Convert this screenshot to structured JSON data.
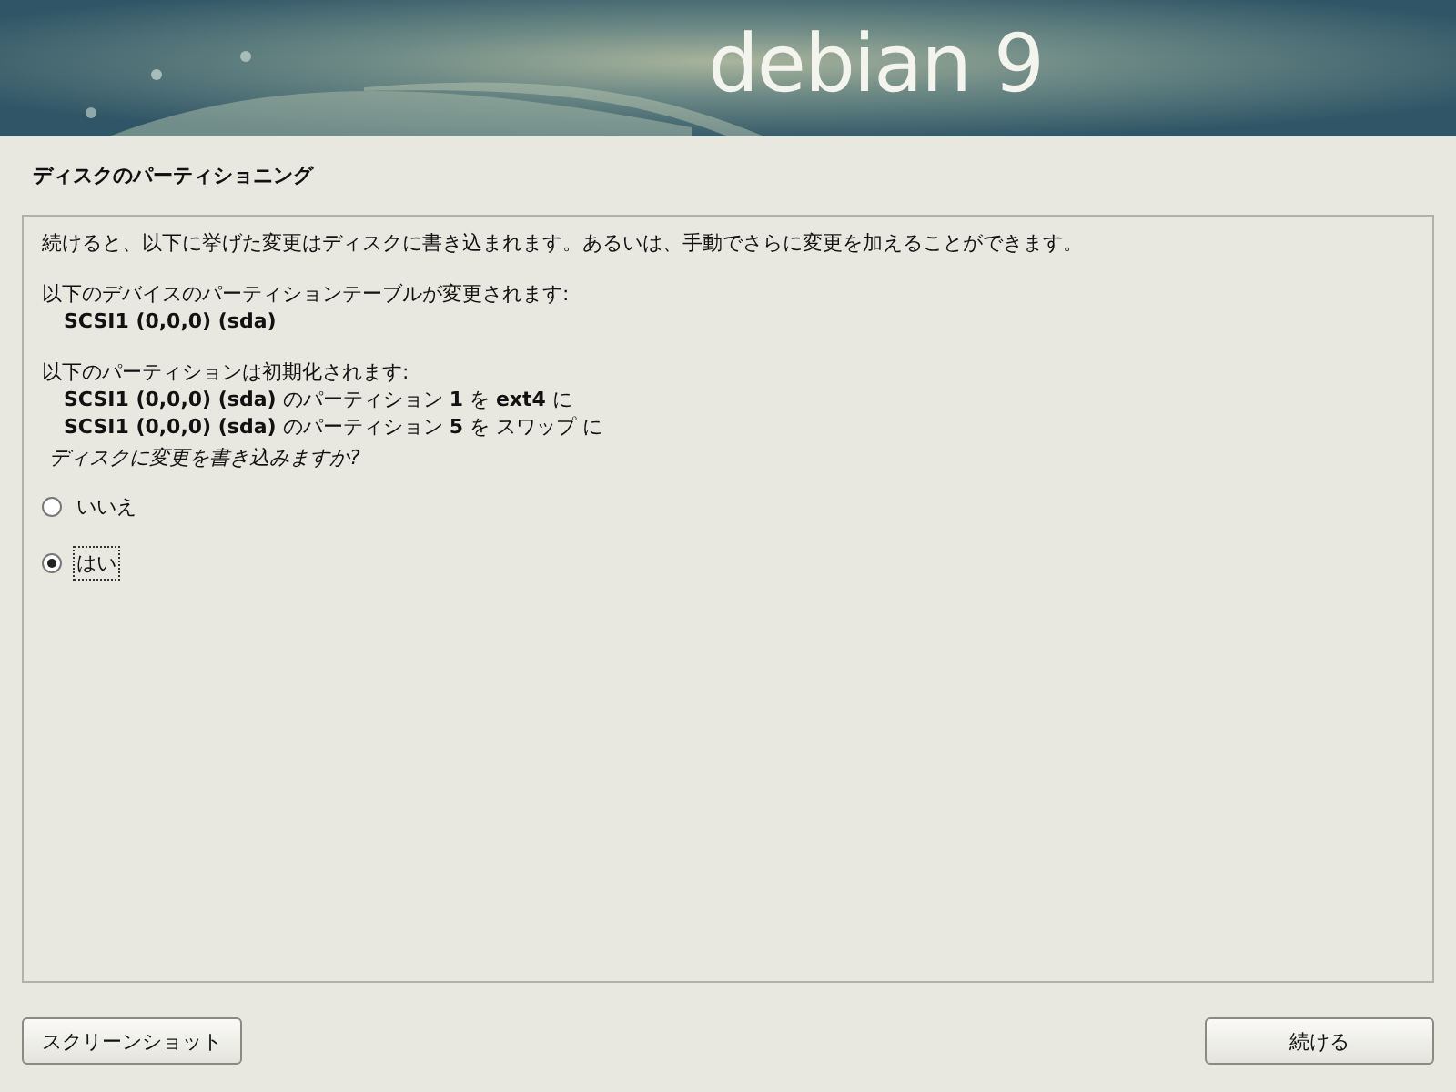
{
  "banner": {
    "logo": "debian 9"
  },
  "title": "ディスクのパーティショニング",
  "paragraphs": [
    {
      "lines": [
        "続けると、以下に挙げた変更はディスクに書き込まれます。あるいは、手動でさらに変更を加えることができます。"
      ]
    },
    {
      "lines": [
        "以下のデバイスのパーティションテーブルが変更されます:",
        "**SCSI1 (0,0,0) (sda)**"
      ]
    },
    {
      "lines": [
        "以下のパーティションは初期化されます:",
        "**SCSI1 (0,0,0) (sda)** のパーティション **1** を **ext4** に",
        "**SCSI1 (0,0,0) (sda)** のパーティション **5** を スワップ に"
      ]
    }
  ],
  "question": "ディスクに変更を書き込みますか?",
  "options": [
    {
      "label": "いいえ",
      "selected": false
    },
    {
      "label": "はい",
      "selected": true
    }
  ],
  "buttons": {
    "left": "スクリーンショット",
    "right": "続ける"
  }
}
